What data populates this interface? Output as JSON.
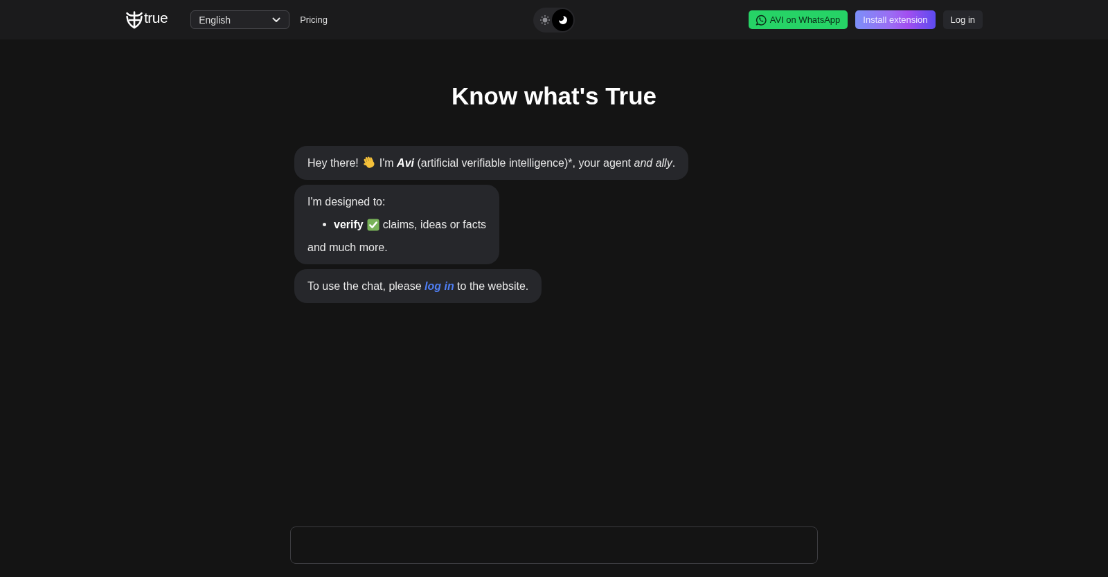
{
  "header": {
    "brand": "true",
    "language_select": {
      "value": "English"
    },
    "nav_links": [
      "Pricing"
    ],
    "theme_toggle": {
      "options": [
        {
          "kind": "light",
          "selected": false
        },
        {
          "kind": "dark",
          "selected": true
        }
      ]
    },
    "buttons": [
      {
        "kind": "whatsapp",
        "label": "AVI on WhatsApp"
      },
      {
        "kind": "extension",
        "label": "Install extension"
      },
      {
        "kind": "login",
        "label": "Log in"
      }
    ]
  },
  "title": "Know what's True",
  "messages": [
    {
      "kind": "greeting",
      "lead": "Hey there!",
      "text": "I'm **Avi** (artificial verifiable intelligence)",
      "footnote_mark": "*",
      "tail": ", your agent *and ally*."
    },
    {
      "kind": "list",
      "intro": "I'm designed to:",
      "items": [
        {
          "term": "verify",
          "text": "claims, ideas or facts"
        }
      ],
      "outro": "and much more."
    },
    {
      "kind": "login",
      "before": "To use the chat, please",
      "link": "log in",
      "after": "to the website."
    }
  ]
}
